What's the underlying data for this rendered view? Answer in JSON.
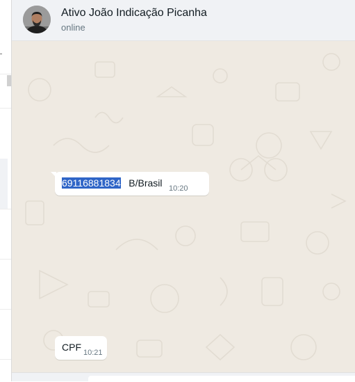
{
  "header": {
    "title": "Ativo João Indicação Picanha",
    "status": "online"
  },
  "messages": [
    {
      "highlighted": "69116881834",
      "text": "   B/Brasil",
      "time": "10:20"
    },
    {
      "highlighted": "",
      "text": "CPF",
      "time": "10:21"
    }
  ],
  "colors": {
    "header_bg": "#f0f2f5",
    "chat_bg": "#efeae2",
    "bubble_bg": "#ffffff",
    "selection": "#2f65c7"
  },
  "icons": [
    "contact-avatar"
  ]
}
